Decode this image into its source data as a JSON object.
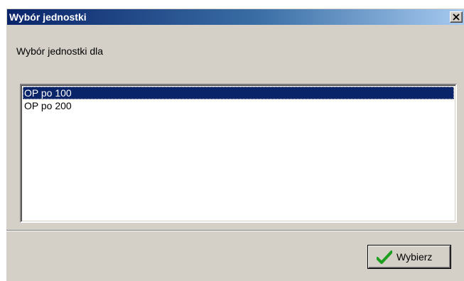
{
  "window": {
    "title": "Wybór jednostki",
    "prompt": "Wybór jednostki dla"
  },
  "list": {
    "items": [
      {
        "label": "OP po 100",
        "selected": true
      },
      {
        "label": "OP po 200",
        "selected": false
      }
    ]
  },
  "buttons": {
    "ok_label": "Wybierz",
    "close_icon": "close-icon",
    "ok_icon": "checkmark-icon"
  },
  "colors": {
    "titlebar_start": "#0a246a",
    "selection": "#0a246a",
    "face": "#d4d0c8",
    "check_green": "#1e9e1e"
  }
}
